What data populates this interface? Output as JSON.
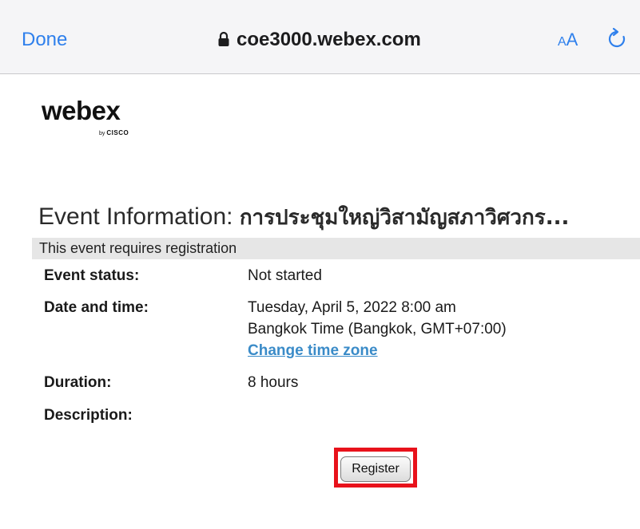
{
  "browser": {
    "done_label": "Done",
    "url": "coe3000.webex.com",
    "text_size_small": "A",
    "text_size_large": "A",
    "accent_color": "#2f80ec"
  },
  "logo": {
    "name": "webex",
    "by": "by",
    "company": "CISCO"
  },
  "event": {
    "heading_label": "Event Information:",
    "heading_title": "การประชุมใหญ่วิสามัญสภาวิศวกร...",
    "registration_note": "This event requires registration",
    "status_label": "Event status:",
    "status_value": "Not started",
    "datetime_label": "Date and time:",
    "date_value": "Tuesday, April 5, 2022 8:00 am",
    "timezone_value": "Bangkok Time (Bangkok, GMT+07:00)",
    "change_timezone_link": "Change time zone",
    "duration_label": "Duration:",
    "duration_value": "8 hours",
    "description_label": "Description:",
    "register_button": "Register",
    "highlight_color": "#e8121b"
  }
}
